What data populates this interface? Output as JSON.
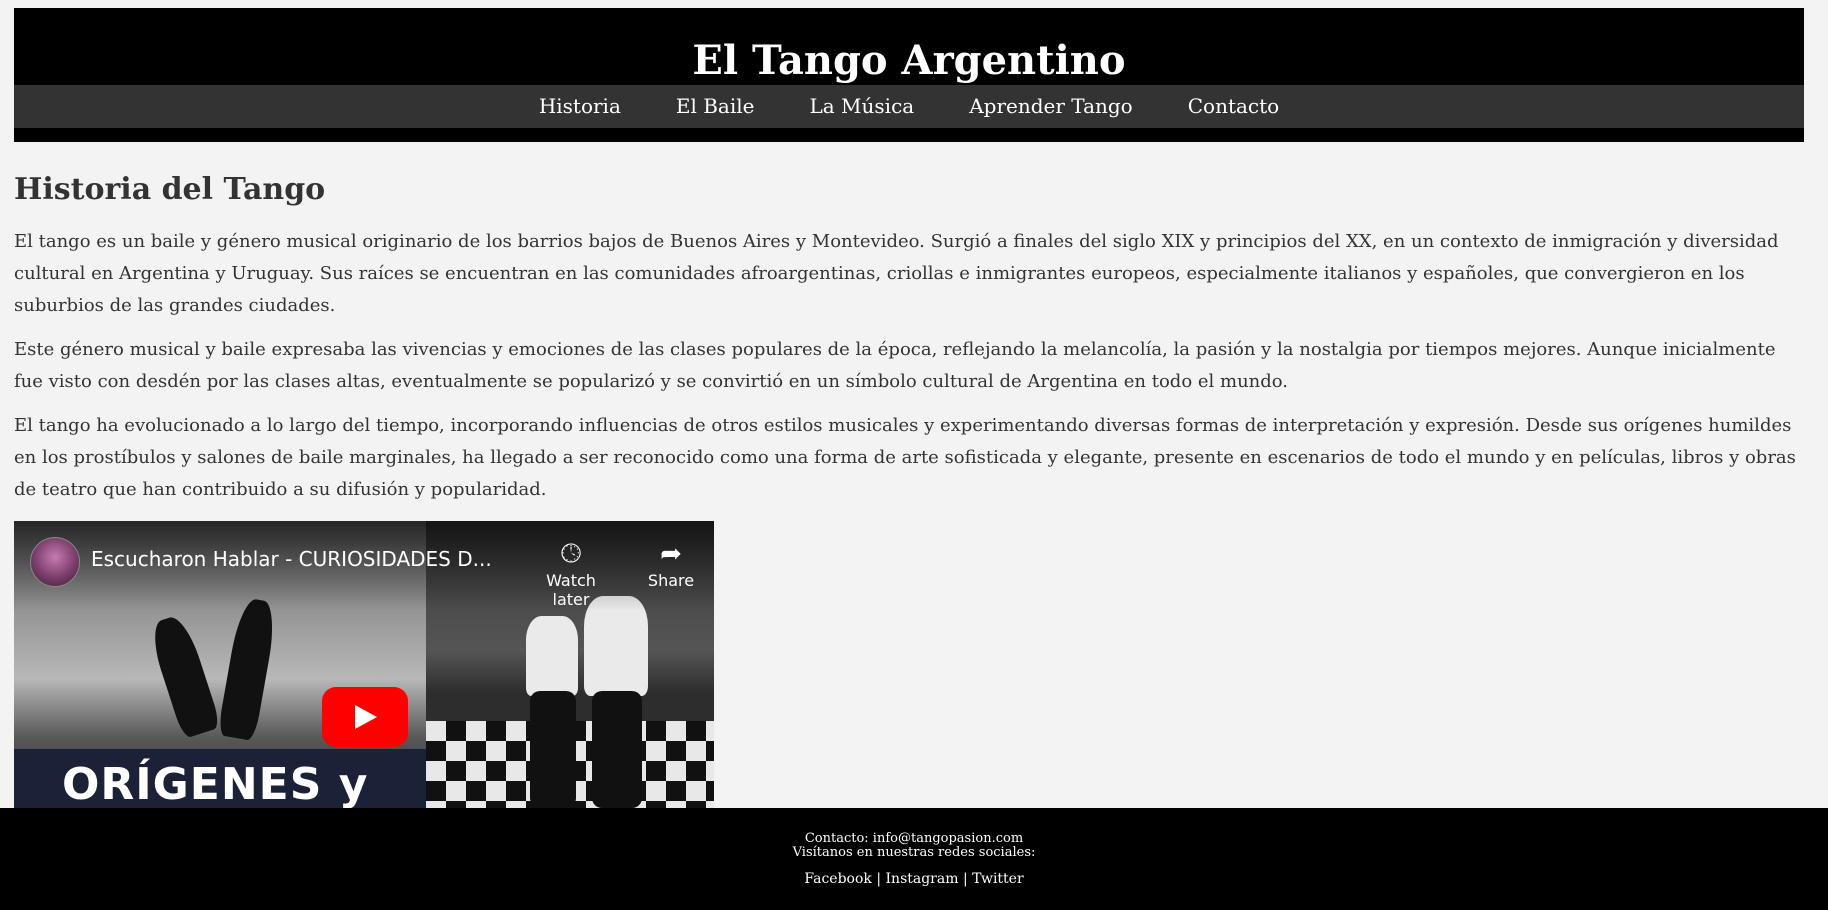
{
  "header": {
    "title": "El Tango Argentino"
  },
  "nav": {
    "items": [
      {
        "label": "Historia"
      },
      {
        "label": "El Baile"
      },
      {
        "label": "La Música"
      },
      {
        "label": "Aprender Tango"
      },
      {
        "label": "Contacto"
      }
    ]
  },
  "main": {
    "heading": "Historia del Tango",
    "paragraphs": [
      "El tango es un baile y género musical originario de los barrios bajos de Buenos Aires y Montevideo. Surgió a finales del siglo XIX y principios del XX, en un contexto de inmigración y diversidad cultural en Argentina y Uruguay. Sus raíces se encuentran en las comunidades afroargentinas, criollas e inmigrantes europeos, especialmente italianos y españoles, que convergieron en los suburbios de las grandes ciudades.",
      "Este género musical y baile expresaba las vivencias y emociones de las clases populares de la época, reflejando la melancolía, la pasión y la nostalgia por tiempos mejores. Aunque inicialmente fue visto con desdén por las clases altas, eventualmente se popularizó y se convirtió en un símbolo cultural de Argentina en todo el mundo.",
      "El tango ha evolucionado a lo largo del tiempo, incorporando influencias de otros estilos musicales y experimentando diversas formas de interpretación y expresión. Desde sus orígenes humildes en los prostíbulos y salones de baile marginales, ha llegado a ser reconocido como una forma de arte sofisticada y elegante, presente en escenarios de todo el mundo y en películas, libros y obras de teatro que han contribuido a su difusión y popularidad."
    ]
  },
  "video": {
    "title": "Escucharon Hablar - CURIOSIDADES D...",
    "thumbnail_text": "ORÍGENES y",
    "watch_later_label": "Watch later",
    "share_label": "Share",
    "icons": {
      "watch_later": "clock-icon",
      "share": "share-arrow-icon",
      "play": "play-icon"
    },
    "play_button_color": "#ff0000"
  },
  "footer": {
    "contact": "Contacto: info@tangopasion.com",
    "social_intro": "Visítanos en nuestras redes sociales:",
    "social_links": [
      {
        "label": "Facebook"
      },
      {
        "label": "Instagram"
      },
      {
        "label": "Twitter"
      }
    ],
    "separator": "|"
  },
  "colors": {
    "page_background": "#f3f3f3",
    "header_background": "#000000",
    "nav_background": "#333333",
    "text": "#333333",
    "footer_background": "#000000"
  }
}
